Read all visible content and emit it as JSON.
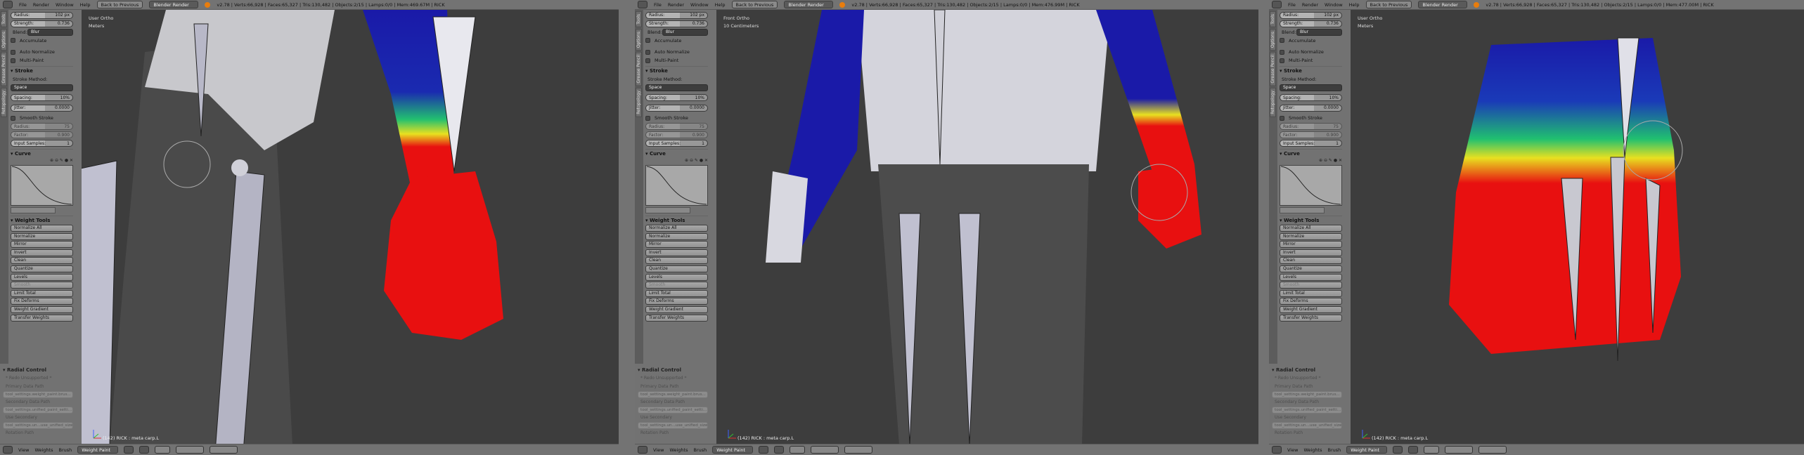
{
  "header": {
    "menus": [
      "File",
      "Render",
      "Window",
      "Help"
    ],
    "back_button": "Back to Previous",
    "render_engine": "Blender Render"
  },
  "toolshelf": {
    "tabs": [
      "Tools",
      "Options",
      "Grease Pencil",
      "Retopology"
    ],
    "radius_label": "Radius:",
    "radius_value": "102 px",
    "strength_label": "Strength:",
    "strength_value": "0.736",
    "blend_label": "Blend:",
    "blend_value": "Blur",
    "accumulate": "Accumulate",
    "auto_normalize": "Auto Normalize",
    "multi_paint": "Multi-Paint",
    "stroke_header": "Stroke",
    "stroke_method_label": "Stroke Method:",
    "stroke_method_value": "Space",
    "spacing_label": "Spacing:",
    "spacing_value": "10%",
    "jitter_label": "Jitter:",
    "jitter_value": "0.0000",
    "smooth_stroke": "Smooth Stroke",
    "smooth_radius_label": "Radius:",
    "smooth_radius_value": "75",
    "factor_label": "Factor:",
    "factor_value": "0.900",
    "input_samples_label": "Input Samples:",
    "input_samples_value": "1",
    "curve_header": "Curve",
    "weight_tools_header": "Weight Tools",
    "weight_tools": [
      "Normalize All",
      "Normalize",
      "Mirror",
      "Invert",
      "Clean",
      "Quantize",
      "Levels",
      "Smooth",
      "Limit Total",
      "Fix Deforms",
      "Weight Gradient",
      "Transfer Weights"
    ]
  },
  "radial_control": {
    "header": "Radial Control",
    "redo": "* Redo Unsupported *",
    "primary_label": "Primary Data Path",
    "primary_value": "tool_settings.weight_paint.brus...",
    "secondary_label": "Secondary Data Path",
    "secondary_value": "tool_settings.unified_paint_setti...",
    "use_secondary_label": "Use Secondary",
    "use_secondary_value": "tool_settings.un...use_unified_size",
    "rotation_label": "Rotation Path"
  },
  "footer": {
    "menus": [
      "View",
      "Weights",
      "Brush"
    ],
    "mode": "Weight Paint"
  },
  "panels": [
    {
      "stats": "v2.78 | Verts:66,928 | Faces:65,327 | Tris:130,482 | Objects:2/15 | Lamps:0/0 | Mem:469.67M | RICK",
      "view": "User Ortho",
      "units": "Meters",
      "object": "(142) RICK : meta carp.L"
    },
    {
      "stats": "v2.78 | Verts:66,928 | Faces:65,327 | Tris:130,482 | Objects:2/15 | Lamps:0/0 | Mem:476.99M | RICK",
      "view": "Front Ortho",
      "units": "10 Centimeters",
      "object": "(142) RICK : meta carp.L"
    },
    {
      "stats": "v2.78 | Verts:66,928 | Faces:65,327 | Tris:130,482 | Objects:2/15 | Lamps:0/0 | Mem:477.00M | RICK",
      "view": "User Ortho",
      "units": "Meters",
      "object": "(142) RICK : meta carp.L"
    }
  ],
  "colors": {
    "weight_low": "#1a1aa8",
    "weight_high": "#e81010",
    "viewport": "#3d3d3d"
  }
}
